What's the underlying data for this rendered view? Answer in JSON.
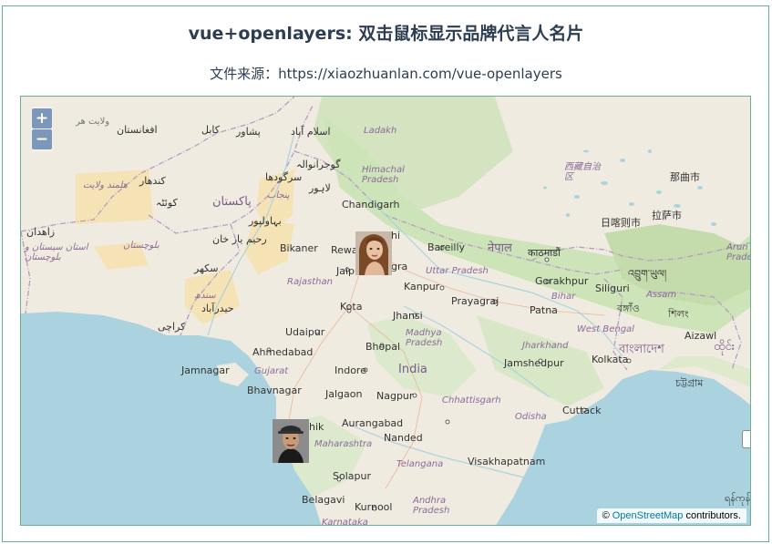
{
  "header": {
    "title": "vue+openlayers: 双击鼠标显示品牌代言人名片",
    "subtitle": "文件来源：https://xiaozhuanlan.com/vue-openlayers"
  },
  "controls": {
    "zoom_in": "+",
    "zoom_out": "−"
  },
  "attribution": {
    "prefix": "©",
    "link": "OpenStreetMap",
    "suffix": " contributors."
  },
  "colors": {
    "border": "#6ab08f",
    "land": "#f0ebe0",
    "sea": "#aad3df",
    "forest": "#cde3b8",
    "desert": "#f5e3b5",
    "title": "#2c3e50"
  },
  "labels": {
    "afghanistan": "افغانستان",
    "kabul": "کابل",
    "peshawar": "پشاور",
    "islamabad": "اسلام آباد",
    "ladakh": "Ladakh",
    "wilayat": "ولایت هر",
    "gujranwala": "گوجرانوالہ",
    "sargodha": "سرگودھا",
    "punjab_pk": "پنجاب",
    "lahore": "لاہور",
    "kandahar": "کندهار",
    "helmand": "هلمند ولایت",
    "quetta": "کوئٹہ",
    "pakistan": "پاکستان",
    "zahedan": "زاهدان",
    "bahawalpur": "بہاولپور",
    "rahim": "رحیم یار خان",
    "balochistan": "بلوچستان",
    "sistan": "استان سیستان و بلوچستان",
    "sukkur": "سکھر",
    "sindh": "سندھ",
    "hyderabad": "حیدرآباد",
    "karachi": "کراچی",
    "himachal": "Himachal\nPradesh",
    "chandigarh": "Chandigarh",
    "tibet": "西藏自治\n区",
    "nagqu": "那曲市",
    "shigatse": "日喀则市",
    "lhasa": "拉萨市",
    "bikaner": "Bikaner",
    "rewari": "Rewa",
    "delhi": "hi",
    "bareilly": "Bareilly",
    "nepal": "नेपाल",
    "kathmandu": "काठमाडौं",
    "jaipur": "Jaipu",
    "agra": "gra",
    "uttar": "Uttar Pradesh",
    "rajasthan": "Rajasthan",
    "kanpur": "Kanpur",
    "prayagraj": "Prayagraj",
    "gorakhpur": "Gorakhpur",
    "siliguri": "Siliguri",
    "bhutan": "འབྲུག་ཡུལ།",
    "assam": "Assam",
    "arunachal": "Arun\nPrade",
    "kota": "Kota",
    "jhansi": "Jhansi",
    "bihar": "Bihar",
    "patna": "Patna",
    "bongaigaon": "বঙ্গাঁও",
    "shillong": "শিলং",
    "udaipur": "Udaipur",
    "madhya": "Madhya\nPradesh",
    "westbengal": "West Bengal",
    "jharkhand": "Jharkhand",
    "aizawl": "Aizawl",
    "ahmedabad": "Ahmedabad",
    "bhopal": "Bhopal",
    "bangladesh": "বাংলাদেশ",
    "myanmar": "ထိုင်း",
    "india": "India",
    "jamshedpur": "Jamshedpur",
    "kolkata": "Kolkata",
    "jamnagar": "Jamnagar",
    "gujarat": "Gujarat",
    "indore": "Indore",
    "chattogram": "চট্টগ্রাম",
    "bhavnagar": "Bhavnagar",
    "jalgaon": "Jalgaon",
    "nagpur": "Nagpur",
    "chhattisgarh": "Chhattisgarh",
    "odisha": "Odisha",
    "cuttack": "Cuttack",
    "nashik": "hik",
    "aurangabad": "Aurangabad",
    "maharashtra": "Maharashtra",
    "nanded": "Nanded",
    "telangana": "Telangana",
    "visakhapatnam": "Visakhapatnam",
    "solapur": "Solapur",
    "belagavi": "Belagavi",
    "kurnool": "Kurnool",
    "andhra": "Andhra\nPradesh",
    "karnataka": "Karnataka",
    "yangon": "ရန်ကုန်"
  },
  "markers": [
    {
      "name": "endorser-female"
    },
    {
      "name": "endorser-male"
    }
  ]
}
